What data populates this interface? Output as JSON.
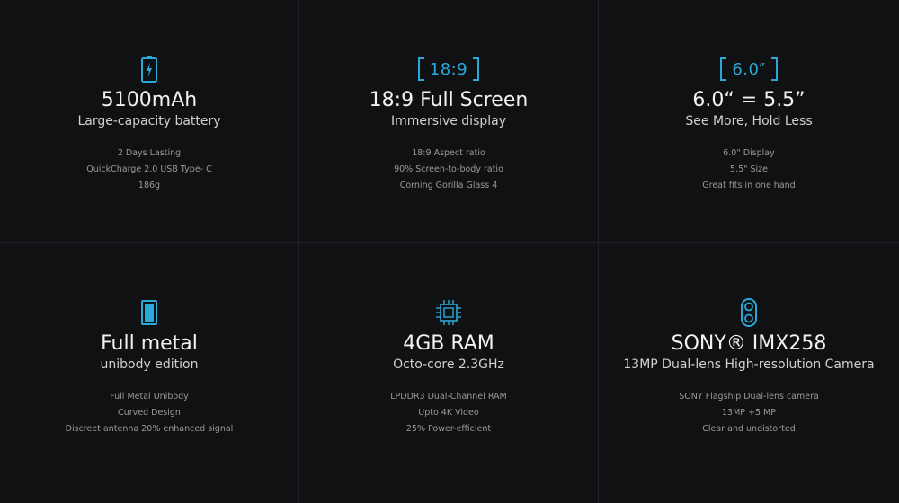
{
  "colors": {
    "background": "#0f1012",
    "accent": "#2aa8d8",
    "title": "#f2f2f2",
    "subtitle": "#d0d0d0",
    "feature": "#9a9a9a"
  },
  "cards": [
    {
      "icon": "battery-charging-icon",
      "title": "5100mAh",
      "subtitle": "Large-capacity battery",
      "features": [
        "2 Days Lasting",
        "QuickCharge 2.0  USB Type- C",
        "186g"
      ]
    },
    {
      "icon": "aspect-ratio-badge",
      "badge": "18:9",
      "title": "18:9 Full Screen",
      "subtitle": "Immersive display",
      "features": [
        "18:9 Aspect ratio",
        "90% Screen-to-body ratio",
        "Corning Gorilla Glass 4"
      ]
    },
    {
      "icon": "screen-size-badge",
      "badge": "6.0″",
      "title": "6.0“ = 5.5”",
      "subtitle": "See More, Hold Less",
      "features": [
        "6.0\" Display",
        "5.5\" Size",
        "Great fits in one hand"
      ]
    },
    {
      "icon": "phone-body-icon",
      "title": "Full metal",
      "subtitle": "unibody edition",
      "features": [
        "Full Metal Unibody",
        "Curved Design",
        "Discreet antenna 20% enhanced signal"
      ]
    },
    {
      "icon": "chip-icon",
      "title": "4GB RAM",
      "subtitle": "Octo-core 2.3GHz",
      "features": [
        "LPDDR3 Dual-Channel RAM",
        "Upto 4K Video",
        "25% Power-efficient"
      ]
    },
    {
      "icon": "dual-camera-icon",
      "title": "SONY® IMX258",
      "subtitle": "13MP Dual-lens High-resolution Camera",
      "features": [
        "SONY Flagship Dual-lens camera",
        "13MP +5 MP",
        "Clear and undistorted"
      ]
    }
  ]
}
